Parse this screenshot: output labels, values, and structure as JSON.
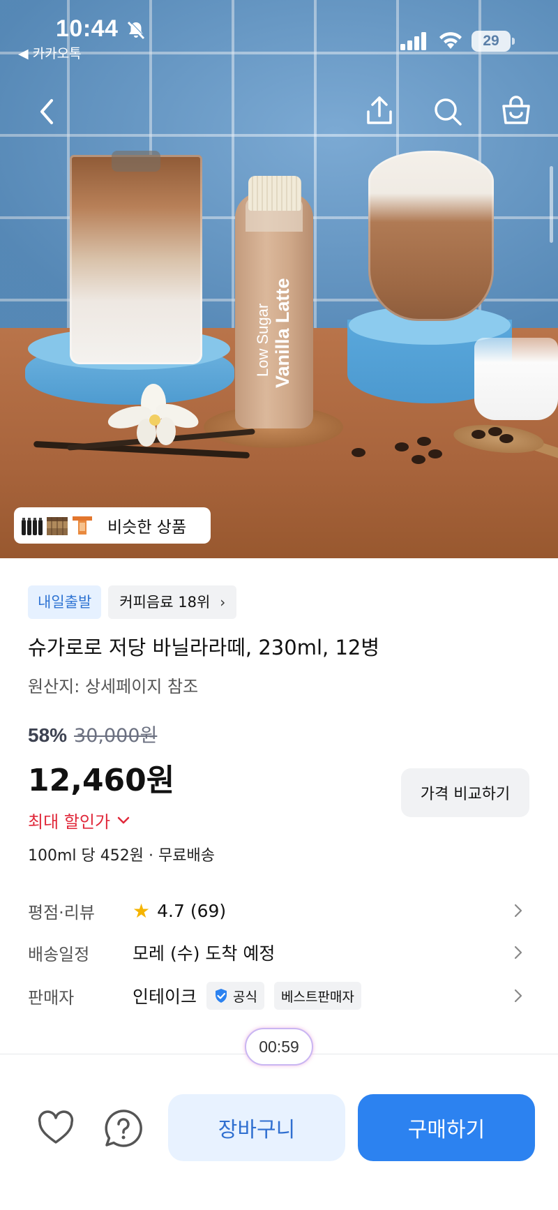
{
  "status_bar": {
    "time": "10:44",
    "back_app": "◀ 카카오톡",
    "battery": "29"
  },
  "hero": {
    "similar_products_label": "비슷한 상품",
    "bottle_text_small": "Low Sugar",
    "bottle_text_large": "Vanilla Latte"
  },
  "product": {
    "badge_delivery": "내일출발",
    "badge_rank": "커피음료 18위",
    "title": "슈가로로 저당 바닐라라떼, 230ml, 12병",
    "origin": "원산지: 상세페이지 참조",
    "discount_percent": "58%",
    "original_price": "30,000원",
    "price": "12,460원",
    "max_discount_label": "최대 할인가",
    "unit_price": "100ml 당 452원 · 무료배송",
    "compare_button": "가격 비교하기"
  },
  "info": {
    "rating_label": "평점·리뷰",
    "rating_value": "4.7 (69)",
    "delivery_label": "배송일정",
    "delivery_value": "모레 (수) 도착 예정",
    "seller_label": "판매자",
    "seller_name": "인테이크",
    "seller_official": "공식",
    "seller_best": "베스트판매자"
  },
  "timer": "00:59",
  "bottom_bar": {
    "cart_button": "장바구니",
    "buy_button": "구매하기"
  },
  "colors": {
    "accent_blue": "#2c82f0",
    "light_blue": "#e8f2ff",
    "discount_red": "#e0283a",
    "star_yellow": "#f5b400"
  }
}
